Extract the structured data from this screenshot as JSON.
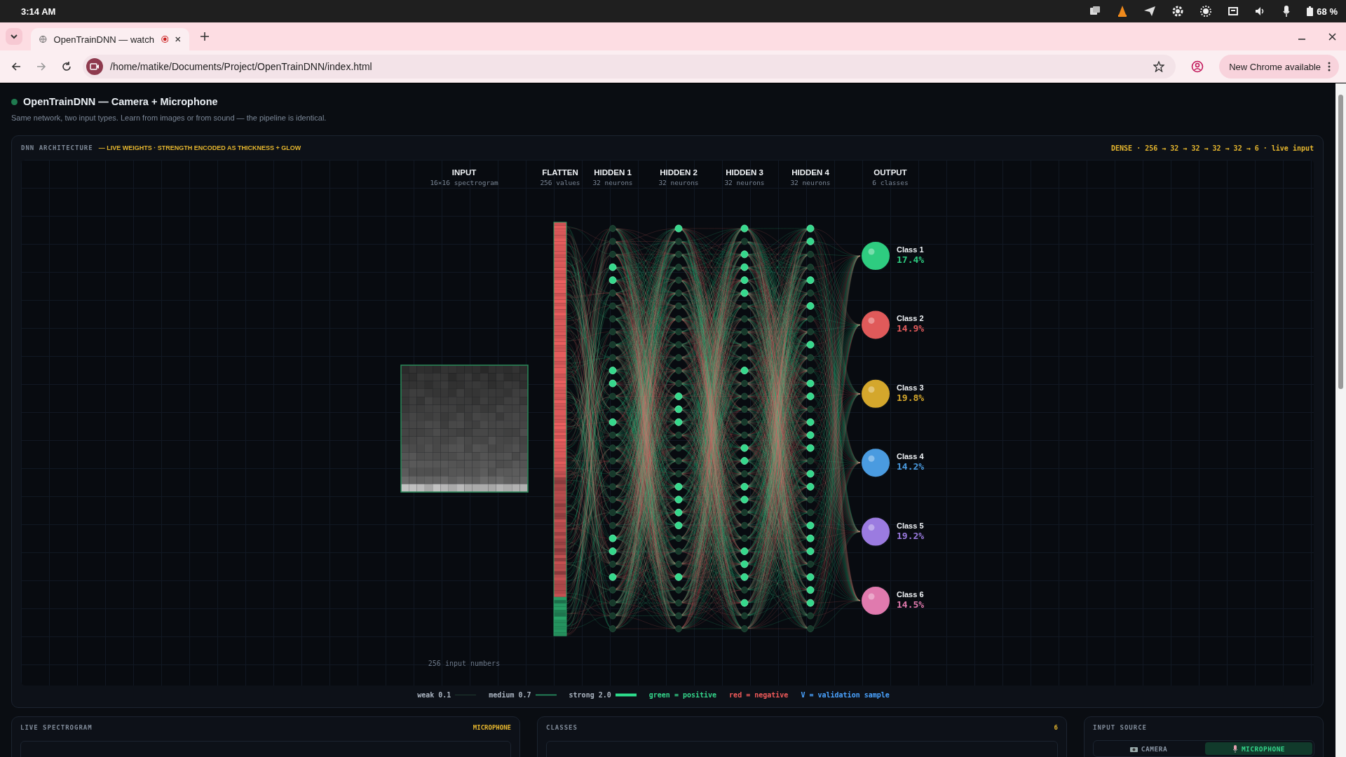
{
  "system_bar": {
    "time": "3:14 AM",
    "battery": "68 %"
  },
  "browser": {
    "tab_title": "OpenTrainDNN — watch",
    "url": "/home/matike/Documents/Project/OpenTrainDNN/index.html",
    "update_button": "New Chrome available"
  },
  "header": {
    "title": "OpenTrainDNN — Camera + Microphone",
    "subtitle": "Same network, two input types. Learn from images or from sound — the pipeline is identical."
  },
  "architecture": {
    "label": "DNN ARCHITECTURE",
    "note": "— LIVE WEIGHTS · STRENGTH ENCODED AS THICKNESS + GLOW",
    "summary": "DENSE · 256 → 32 → 32 → 32 → 32 → 6 · live input",
    "layers": [
      {
        "title": "INPUT",
        "subtitle": "16×16 spectrogram",
        "kind": "image"
      },
      {
        "title": "FLATTEN",
        "subtitle": "256 values",
        "kind": "flatten"
      },
      {
        "title": "HIDDEN 1",
        "subtitle": "32 neurons",
        "kind": "dense"
      },
      {
        "title": "HIDDEN 2",
        "subtitle": "32 neurons",
        "kind": "dense"
      },
      {
        "title": "HIDDEN 3",
        "subtitle": "32 neurons",
        "kind": "dense"
      },
      {
        "title": "HIDDEN 4",
        "subtitle": "32 neurons",
        "kind": "dense"
      },
      {
        "title": "OUTPUT",
        "subtitle": "6 classes",
        "kind": "output"
      }
    ],
    "input_caption": "256 input numbers",
    "outputs": [
      {
        "name": "Class 1",
        "percent": "17.4%",
        "color": "#2ecc80"
      },
      {
        "name": "Class 2",
        "percent": "14.9%",
        "color": "#e05a5a"
      },
      {
        "name": "Class 3",
        "percent": "19.8%",
        "color": "#d4a72c"
      },
      {
        "name": "Class 4",
        "percent": "14.2%",
        "color": "#4a9be0"
      },
      {
        "name": "Class 5",
        "percent": "19.2%",
        "color": "#9b7be0"
      },
      {
        "name": "Class 6",
        "percent": "14.5%",
        "color": "#e07aae"
      }
    ]
  },
  "legend": [
    {
      "label": "weak 0.1",
      "kind": "weak"
    },
    {
      "label": "medium 0.7",
      "kind": "medium"
    },
    {
      "label": "strong 2.0",
      "kind": "strong"
    },
    {
      "label": "green = positive",
      "kind": "note",
      "color": "#34d48a"
    },
    {
      "label": "red = negative",
      "kind": "note",
      "color": "#f05a5a"
    },
    {
      "label": "V = validation sample",
      "kind": "note",
      "color": "#4aa3ff"
    }
  ],
  "panels": [
    {
      "title": "LIVE SPECTROGRAM",
      "badge": "MICROPHONE",
      "kind": "spectrogram"
    },
    {
      "title": "CLASSES",
      "badge": "6",
      "kind": "classes"
    },
    {
      "title": "INPUT SOURCE",
      "kind": "source",
      "tabs": [
        {
          "label": "CAMERA",
          "selected": false
        },
        {
          "label": "MICROPHONE",
          "selected": true
        }
      ]
    }
  ]
}
